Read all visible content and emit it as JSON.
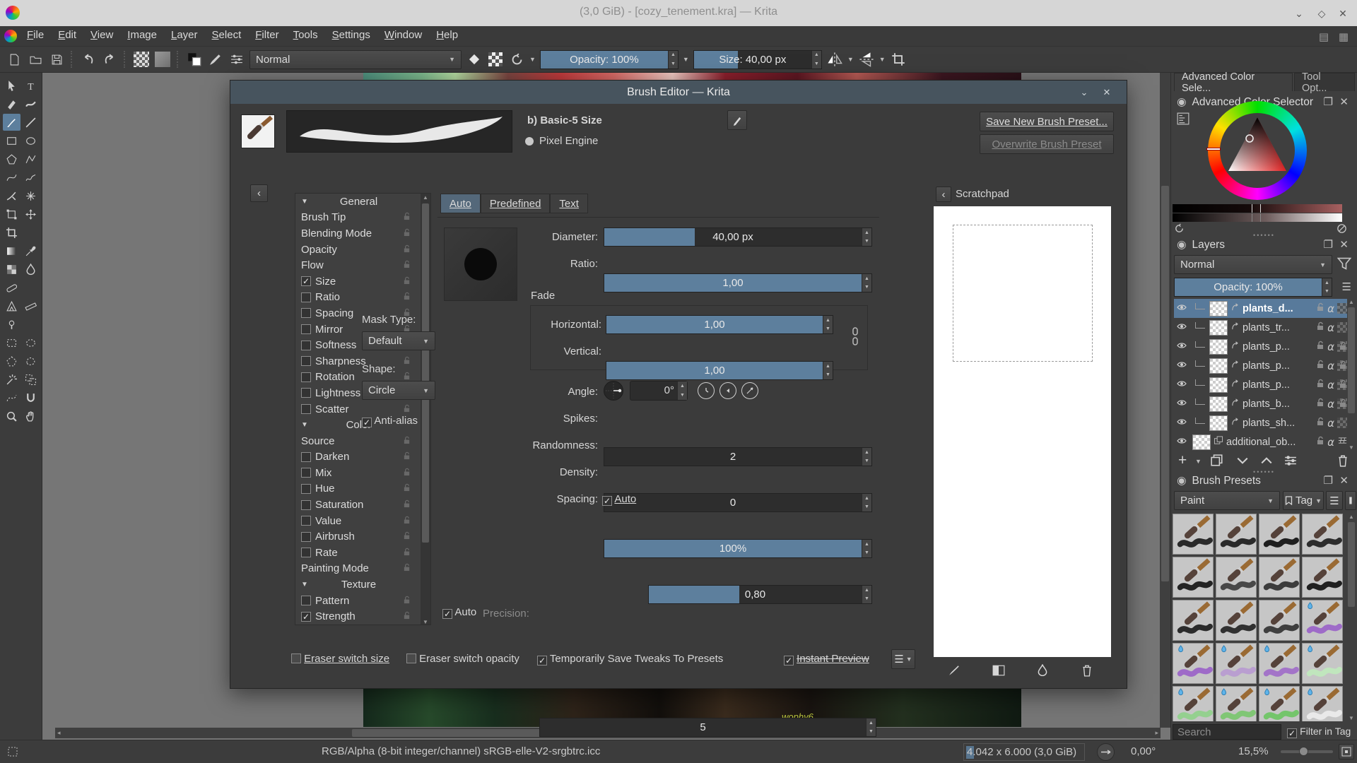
{
  "titlebar": {
    "title": "(3,0 GiB) - [cozy_tenement.kra] — Krita"
  },
  "menubar": {
    "items": [
      "File",
      "Edit",
      "View",
      "Image",
      "Layer",
      "Select",
      "Filter",
      "Tools",
      "Settings",
      "Window",
      "Help"
    ]
  },
  "toolbar": {
    "blending_mode": "Normal",
    "opacity": "Opacity: 100%",
    "size": "Size: 40,00 px"
  },
  "toolbox": {
    "rows": [
      [
        "pointer",
        "text"
      ],
      [
        "editshapes",
        "calligraphy"
      ],
      [
        "brush",
        "line"
      ],
      [
        "rect",
        "ellipse"
      ],
      [
        "polygon",
        "polyline"
      ],
      [
        "bezier",
        "freehand"
      ],
      [
        "dynabrush",
        "multibrush"
      ],
      [
        "transform",
        "move"
      ],
      [
        "crop",
        null
      ],
      [
        "gradient",
        "sampler"
      ],
      [
        "pattern",
        "colorize"
      ],
      [
        "patch",
        null
      ],
      [
        "assistant",
        "measure"
      ],
      [
        "reference",
        null
      ],
      [
        "selrect",
        "selellipse"
      ],
      [
        "selpoly",
        "selfree"
      ],
      [
        "selwand",
        "selsimilar"
      ],
      [
        "selbezier",
        "selmagnetic"
      ],
      [
        "zoom",
        "pan"
      ]
    ],
    "selected": "brush"
  },
  "canvas": {
    "signature": "wophy6"
  },
  "dialog": {
    "title": "Brush Editor — Krita",
    "preset_name": "b) Basic-5 Size",
    "engine": "Pixel Engine",
    "save_new": "Save New Brush Preset...",
    "overwrite": "Overwrite Brush Preset",
    "tabs": [
      "Auto",
      "Predefined",
      "Text"
    ],
    "options": [
      {
        "type": "header",
        "label": "General"
      },
      {
        "type": "plain",
        "label": "Brush Tip"
      },
      {
        "type": "plain",
        "label": "Blending Mode"
      },
      {
        "type": "plain",
        "label": "Opacity"
      },
      {
        "type": "plain",
        "label": "Flow"
      },
      {
        "type": "check",
        "label": "Size",
        "checked": true
      },
      {
        "type": "check",
        "label": "Ratio",
        "checked": false
      },
      {
        "type": "check",
        "label": "Spacing",
        "checked": false
      },
      {
        "type": "check",
        "label": "Mirror",
        "checked": false
      },
      {
        "type": "check",
        "label": "Softness",
        "checked": false
      },
      {
        "type": "check",
        "label": "Sharpness",
        "checked": false
      },
      {
        "type": "check",
        "label": "Rotation",
        "checked": false
      },
      {
        "type": "check",
        "label": "Lightness Stre...",
        "checked": false
      },
      {
        "type": "check",
        "label": "Scatter",
        "checked": false
      },
      {
        "type": "header",
        "label": "Color"
      },
      {
        "type": "plain",
        "label": "Source"
      },
      {
        "type": "check",
        "label": "Darken",
        "checked": false
      },
      {
        "type": "check",
        "label": "Mix",
        "checked": false
      },
      {
        "type": "check",
        "label": "Hue",
        "checked": false
      },
      {
        "type": "check",
        "label": "Saturation",
        "checked": false
      },
      {
        "type": "check",
        "label": "Value",
        "checked": false
      },
      {
        "type": "check",
        "label": "Airbrush",
        "checked": false
      },
      {
        "type": "check",
        "label": "Rate",
        "checked": false
      },
      {
        "type": "plain",
        "label": "Painting Mode"
      },
      {
        "type": "header",
        "label": "Texture"
      },
      {
        "type": "check",
        "label": "Pattern",
        "checked": false
      },
      {
        "type": "check",
        "label": "Strength",
        "checked": true
      }
    ],
    "mask_type_label": "Mask Type:",
    "mask_type_value": "Default",
    "shape_label": "Shape:",
    "shape_value": "Circle",
    "antialias": "Anti-alias",
    "params": {
      "diameter_label": "Diameter:",
      "diameter": "40,00 px",
      "ratio_label": "Ratio:",
      "ratio": "1,00",
      "fade_label": "Fade",
      "horizontal_label": "Horizontal:",
      "horizontal": "1,00",
      "vertical_label": "Vertical:",
      "vertical": "1,00",
      "angle_label": "Angle:",
      "angle": "0°",
      "spikes_label": "Spikes:",
      "spikes": "2",
      "randomness_label": "Randomness:",
      "randomness": "0",
      "density_label": "Density:",
      "density": "100%",
      "spacing_label": "Spacing:",
      "spacing_auto": "Auto",
      "spacing": "0,80",
      "auto_label": "Auto",
      "precision_label": "Precision:",
      "precision": "5"
    },
    "footer": {
      "eraser_size": "Eraser switch size",
      "eraser_opacity": "Eraser switch opacity",
      "tweaks": "Temporarily Save Tweaks To Presets",
      "instant": "Instant Preview"
    },
    "scratchpad_title": "Scratchpad"
  },
  "docks": {
    "tabs": [
      "Advanced Color Sele...",
      "Tool Opt..."
    ],
    "color_selector": {
      "title": "Advanced Color Selector"
    },
    "layers": {
      "title": "Layers",
      "blending_mode": "Normal",
      "opacity": "Opacity:  100%",
      "rows": [
        {
          "name": "plants_d...",
          "selected": true,
          "badge": "checker"
        },
        {
          "name": "plants_tr...",
          "selected": false,
          "badge": "checker"
        },
        {
          "name": "plants_p...",
          "selected": false,
          "badge": "lockcheck"
        },
        {
          "name": "plants_p...",
          "selected": false,
          "badge": "lockcheck"
        },
        {
          "name": "plants_p...",
          "selected": false,
          "badge": "lockcheck"
        },
        {
          "name": "plants_b...",
          "selected": false,
          "badge": "lockcheck"
        },
        {
          "name": "plants_sh...",
          "selected": false,
          "badge": "checker"
        },
        {
          "name": "additional_ob...",
          "selected": false,
          "badge": "bricks",
          "group": true
        }
      ]
    },
    "presets": {
      "title": "Brush Presets",
      "tag_filter": "Paint",
      "tag_button": "Tag",
      "search_placeholder": "Search",
      "filter_in_tag": "Filter in Tag",
      "cells": [
        {
          "stroke": "#1c1c1c",
          "drop": false
        },
        {
          "stroke": "#1c1c1c",
          "drop": false
        },
        {
          "stroke": "#101010",
          "drop": false
        },
        {
          "stroke": "#202020",
          "drop": false
        },
        {
          "stroke": "#161616",
          "drop": false
        },
        {
          "stroke": "#3d3d3d",
          "drop": false
        },
        {
          "stroke": "#303030",
          "drop": false
        },
        {
          "stroke": "#111111",
          "drop": false
        },
        {
          "stroke": "#1d1d1d",
          "drop": false
        },
        {
          "stroke": "#242424",
          "drop": false
        },
        {
          "stroke": "#333333",
          "drop": false
        },
        {
          "stroke": "#9a63c8",
          "drop": true
        },
        {
          "stroke": "#9a63c8",
          "drop": true
        },
        {
          "stroke": "#b79ad0",
          "drop": true
        },
        {
          "stroke": "#a06cc8",
          "drop": true
        },
        {
          "stroke": "#bfe8bc",
          "drop": true
        },
        {
          "stroke": "#8fd08a",
          "drop": true
        },
        {
          "stroke": "#79c66e",
          "drop": true
        },
        {
          "stroke": "#6cc463",
          "drop": true
        },
        {
          "stroke": "#ececec",
          "drop": true
        }
      ]
    }
  },
  "statusbar": {
    "colorspace": "RGB/Alpha (8-bit integer/channel)  sRGB-elle-V2-srgbtrc.icc",
    "dimensions": "4.042 x 6.000 (3,0 GiB)",
    "rotation": "0,00°",
    "zoom": "15,5%"
  }
}
